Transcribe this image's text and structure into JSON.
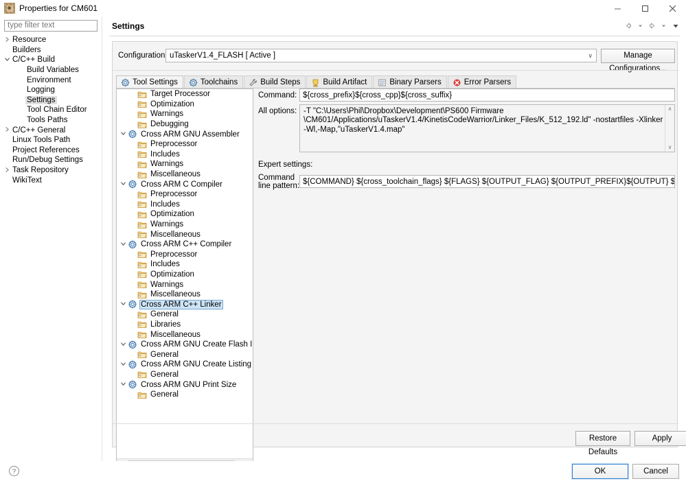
{
  "window": {
    "title": "Properties for CM601",
    "icon": "project-properties-icon",
    "minimize_label": "–",
    "maximize_label": "☐",
    "close_label": "✕"
  },
  "filter": {
    "placeholder": "type filter text",
    "value": ""
  },
  "sidebar": {
    "items": [
      {
        "label": "Resource",
        "indent": 0,
        "arrow": "collapsed",
        "selected": false
      },
      {
        "label": "Builders",
        "indent": 0,
        "arrow": "none",
        "selected": false
      },
      {
        "label": "C/C++ Build",
        "indent": 0,
        "arrow": "expanded",
        "selected": false
      },
      {
        "label": "Build Variables",
        "indent": 1,
        "arrow": "none",
        "selected": false
      },
      {
        "label": "Environment",
        "indent": 1,
        "arrow": "none",
        "selected": false
      },
      {
        "label": "Logging",
        "indent": 1,
        "arrow": "none",
        "selected": false
      },
      {
        "label": "Settings",
        "indent": 1,
        "arrow": "none",
        "selected": true
      },
      {
        "label": "Tool Chain Editor",
        "indent": 1,
        "arrow": "none",
        "selected": false
      },
      {
        "label": "Tools Paths",
        "indent": 1,
        "arrow": "none",
        "selected": false
      },
      {
        "label": "C/C++ General",
        "indent": 0,
        "arrow": "collapsed",
        "selected": false
      },
      {
        "label": "Linux Tools Path",
        "indent": 0,
        "arrow": "none",
        "selected": false
      },
      {
        "label": "Project References",
        "indent": 0,
        "arrow": "none",
        "selected": false
      },
      {
        "label": "Run/Debug Settings",
        "indent": 0,
        "arrow": "none",
        "selected": false
      },
      {
        "label": "Task Repository",
        "indent": 0,
        "arrow": "collapsed",
        "selected": false
      },
      {
        "label": "WikiText",
        "indent": 0,
        "arrow": "none",
        "selected": false
      }
    ]
  },
  "header": {
    "title": "Settings",
    "nav": [
      {
        "name": "back-arrow-icon",
        "glyph": "back"
      },
      {
        "name": "back-dropdown-icon",
        "glyph": "caret"
      },
      {
        "name": "forward-arrow-icon",
        "glyph": "forward"
      },
      {
        "name": "forward-dropdown-icon",
        "glyph": "caret"
      },
      {
        "name": "view-menu-icon",
        "glyph": "caret-filled"
      }
    ]
  },
  "configuration": {
    "label": "Configuration:",
    "value": "uTaskerV1.4_FLASH  [ Active ]",
    "caret": "∨",
    "manage_button": "Manage Configurations..."
  },
  "tabs": [
    {
      "label": "Tool Settings",
      "icon": "tool-settings-icon",
      "active": true
    },
    {
      "label": "Toolchains",
      "icon": "toolchains-icon",
      "active": false
    },
    {
      "label": "Build Steps",
      "icon": "build-steps-icon",
      "active": false
    },
    {
      "label": "Build Artifact",
      "icon": "build-artifact-icon",
      "active": false
    },
    {
      "label": "Binary Parsers",
      "icon": "binary-parsers-icon",
      "active": false
    },
    {
      "label": "Error Parsers",
      "icon": "error-parsers-icon",
      "active": false
    }
  ],
  "tool_tree": {
    "items": [
      {
        "label": "Target Processor",
        "indent": 1,
        "arrow": "none",
        "icon": "folder",
        "selected": false
      },
      {
        "label": "Optimization",
        "indent": 1,
        "arrow": "none",
        "icon": "folder",
        "selected": false
      },
      {
        "label": "Warnings",
        "indent": 1,
        "arrow": "none",
        "icon": "folder",
        "selected": false
      },
      {
        "label": "Debugging",
        "indent": 1,
        "arrow": "none",
        "icon": "folder",
        "selected": false
      },
      {
        "label": "Cross ARM GNU Assembler",
        "indent": 0,
        "arrow": "expanded",
        "icon": "tool",
        "selected": false
      },
      {
        "label": "Preprocessor",
        "indent": 1,
        "arrow": "none",
        "icon": "folder",
        "selected": false
      },
      {
        "label": "Includes",
        "indent": 1,
        "arrow": "none",
        "icon": "folder",
        "selected": false
      },
      {
        "label": "Warnings",
        "indent": 1,
        "arrow": "none",
        "icon": "folder",
        "selected": false
      },
      {
        "label": "Miscellaneous",
        "indent": 1,
        "arrow": "none",
        "icon": "folder",
        "selected": false
      },
      {
        "label": "Cross ARM C Compiler",
        "indent": 0,
        "arrow": "expanded",
        "icon": "tool",
        "selected": false
      },
      {
        "label": "Preprocessor",
        "indent": 1,
        "arrow": "none",
        "icon": "folder",
        "selected": false
      },
      {
        "label": "Includes",
        "indent": 1,
        "arrow": "none",
        "icon": "folder",
        "selected": false
      },
      {
        "label": "Optimization",
        "indent": 1,
        "arrow": "none",
        "icon": "folder",
        "selected": false
      },
      {
        "label": "Warnings",
        "indent": 1,
        "arrow": "none",
        "icon": "folder",
        "selected": false
      },
      {
        "label": "Miscellaneous",
        "indent": 1,
        "arrow": "none",
        "icon": "folder",
        "selected": false
      },
      {
        "label": "Cross ARM C++ Compiler",
        "indent": 0,
        "arrow": "expanded",
        "icon": "tool",
        "selected": false
      },
      {
        "label": "Preprocessor",
        "indent": 1,
        "arrow": "none",
        "icon": "folder",
        "selected": false
      },
      {
        "label": "Includes",
        "indent": 1,
        "arrow": "none",
        "icon": "folder",
        "selected": false
      },
      {
        "label": "Optimization",
        "indent": 1,
        "arrow": "none",
        "icon": "folder",
        "selected": false
      },
      {
        "label": "Warnings",
        "indent": 1,
        "arrow": "none",
        "icon": "folder",
        "selected": false
      },
      {
        "label": "Miscellaneous",
        "indent": 1,
        "arrow": "none",
        "icon": "folder",
        "selected": false
      },
      {
        "label": "Cross ARM C++ Linker",
        "indent": 0,
        "arrow": "expanded",
        "icon": "tool",
        "selected": true
      },
      {
        "label": "General",
        "indent": 1,
        "arrow": "none",
        "icon": "folder",
        "selected": false
      },
      {
        "label": "Libraries",
        "indent": 1,
        "arrow": "none",
        "icon": "folder",
        "selected": false
      },
      {
        "label": "Miscellaneous",
        "indent": 1,
        "arrow": "none",
        "icon": "folder",
        "selected": false
      },
      {
        "label": "Cross ARM GNU Create Flash Image",
        "indent": 0,
        "arrow": "expanded",
        "icon": "tool",
        "selected": false
      },
      {
        "label": "General",
        "indent": 1,
        "arrow": "none",
        "icon": "folder",
        "selected": false
      },
      {
        "label": "Cross ARM GNU Create Listing",
        "indent": 0,
        "arrow": "expanded",
        "icon": "tool",
        "selected": false
      },
      {
        "label": "General",
        "indent": 1,
        "arrow": "none",
        "icon": "folder",
        "selected": false
      },
      {
        "label": "Cross ARM GNU Print Size",
        "indent": 0,
        "arrow": "expanded",
        "icon": "tool",
        "selected": false
      },
      {
        "label": "General",
        "indent": 1,
        "arrow": "none",
        "icon": "folder",
        "selected": false
      }
    ],
    "hscroll_left": "‹",
    "hscroll_right": "›"
  },
  "form": {
    "command_label": "Command:",
    "command_value": "${cross_prefix}${cross_cpp}${cross_suffix}",
    "all_options_label": "All options:",
    "all_options_value": "-T \"C:\\Users\\Phil\\Dropbox\\Development\\PS600 Firmware\\CM601/Applications/uTaskerV1.4/KinetisCodeWarrior/Linker_Files/K_512_192.ld\" -nostartfiles -Xlinker --gc-sections -Wl,-Map,\"uTaskerV1.4.map\"",
    "all_options_lines": [
      "-T \"C:\\Users\\Phil\\Dropbox\\Development\\PS600 Firmware",
      "\\CM601/Applications/uTaskerV1.4/KinetisCodeWarrior/Linker_Files/K_512_192.ld\" -nostartfiles -Xlinker --gc-sections",
      "-Wl,-Map,\"uTaskerV1.4.map\""
    ],
    "expert_settings_label": "Expert settings:",
    "command_line_pattern_label_line1": "Command",
    "command_line_pattern_label_line2": "line pattern:",
    "command_line_pattern_value": "${COMMAND} ${cross_toolchain_flags} ${FLAGS} ${OUTPUT_FLAG} ${OUTPUT_PREFIX}${OUTPUT} ${INPUTS}",
    "scroll_up": "∧",
    "scroll_down": "∨"
  },
  "buttons": {
    "restore_defaults": "Restore Defaults",
    "apply": "Apply",
    "ok": "OK",
    "cancel": "Cancel",
    "help_icon": "help-question-icon"
  },
  "colors": {
    "selection_blue": "#cce4f7",
    "selection_border": "#7ba7cd",
    "sidebar_selection": "#e0e0e0",
    "panel_bg": "#f4f4f4",
    "focus_border": "#2e7dd1",
    "folder_icon": "#e8c473",
    "tool_icon": "#5b8fc9",
    "error_icon": "#d93a3a"
  }
}
